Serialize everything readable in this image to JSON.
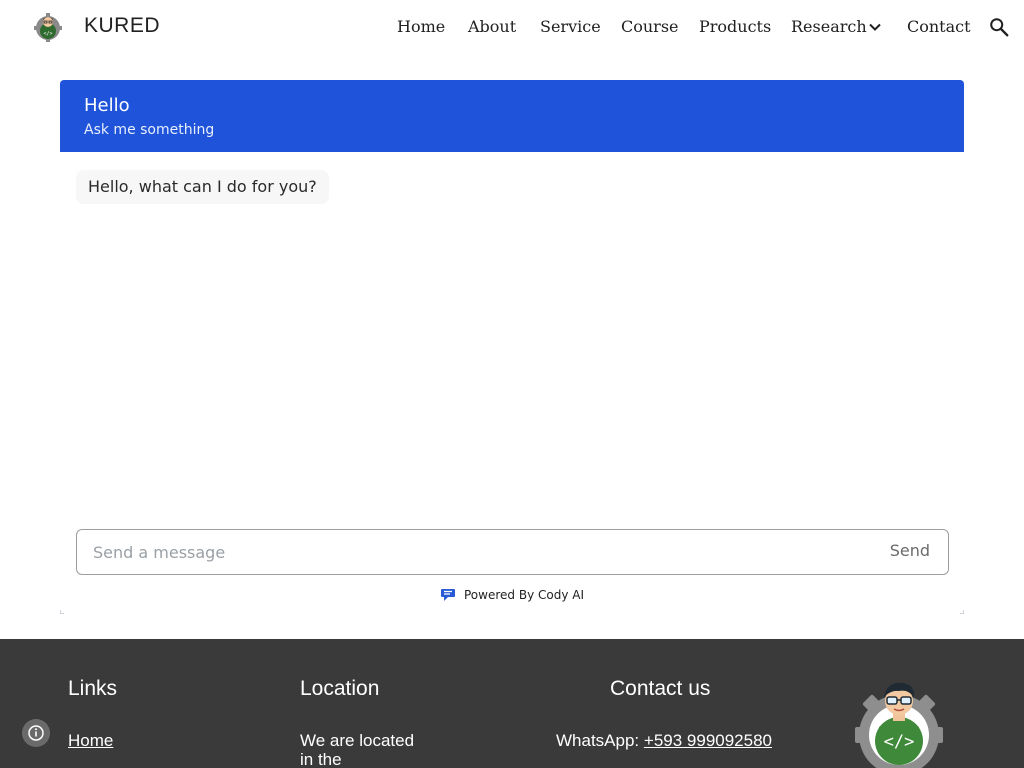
{
  "header": {
    "site_title": "KURED",
    "nav": [
      {
        "label": "Home"
      },
      {
        "label": "About"
      },
      {
        "label": "Service"
      },
      {
        "label": "Course"
      },
      {
        "label": "Products"
      },
      {
        "label": "Research"
      },
      {
        "label": "Contact"
      }
    ]
  },
  "chat": {
    "title": "Hello",
    "subtitle": "Ask me something",
    "greeting": "Hello, what can I do for you?",
    "input_placeholder": "Send a message",
    "input_value": "",
    "send_label": "Send",
    "powered_by": "Powered By Cody AI",
    "accent_color": "#1e53da"
  },
  "footer": {
    "links_heading": "Links",
    "links": [
      {
        "label": "Home"
      }
    ],
    "location_heading": "Location",
    "location_text": "We are located in the",
    "contact_heading": "Contact us",
    "whatsapp_label": "WhatsApp:",
    "whatsapp_number": "+593 999092580",
    "background_color": "#3a3a3a"
  }
}
